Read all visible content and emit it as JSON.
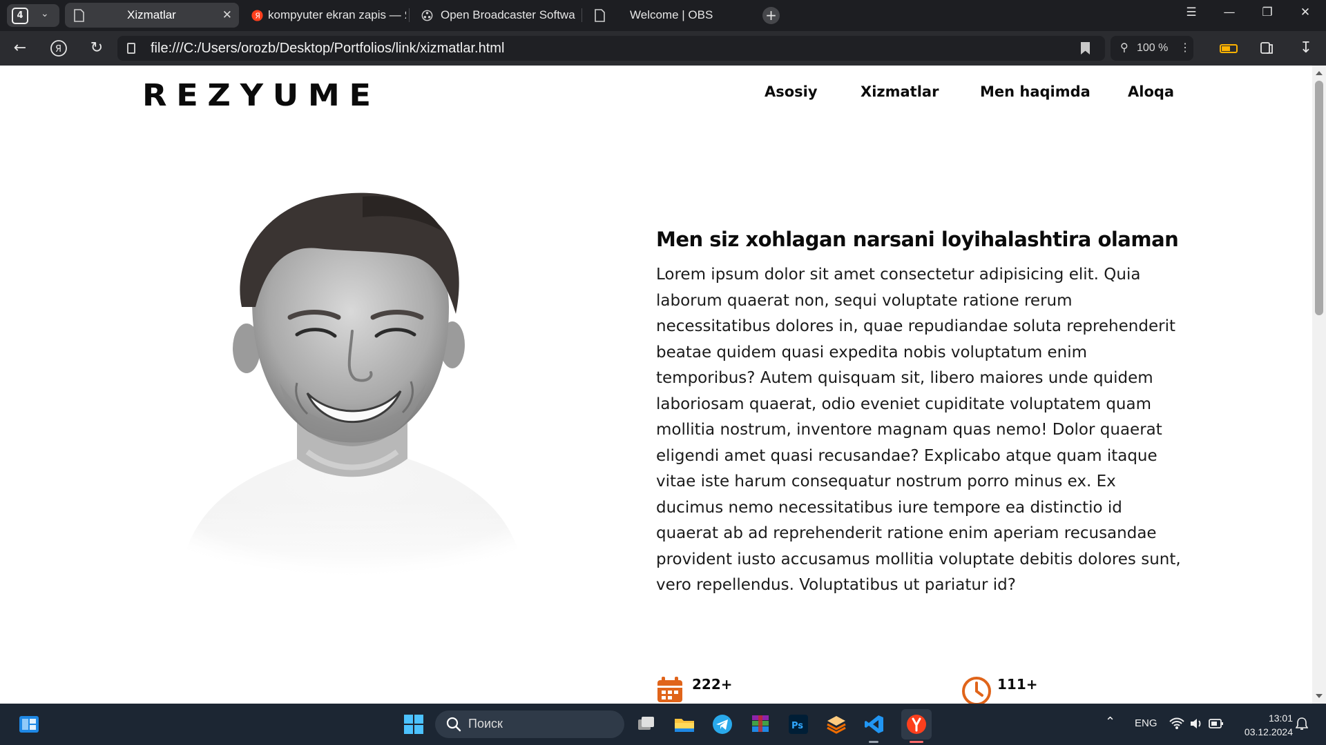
{
  "browser": {
    "tab_count": "4",
    "tabs": [
      {
        "label": "Xizmatlar",
        "active": true
      },
      {
        "label": "kompyuter ekran zapis — Я",
        "active": false
      },
      {
        "label": "Open Broadcaster Softwa",
        "active": false
      },
      {
        "label": "Welcome | OBS",
        "active": false
      }
    ],
    "url": "file:///C:/Users/orozb/Desktop/Portfolios/link/xizmatlar.html",
    "zoom": "100 %"
  },
  "site": {
    "logo": "REZYUME",
    "menu": [
      "Asosiy",
      "Xizmatlar",
      "Men haqimda",
      "Aloqa"
    ],
    "headline": "Men siz xohlagan narsani loyihalashtira olaman",
    "paragraph": "Lorem ipsum dolor sit amet consectetur adipisicing elit. Quia laborum quaerat non, sequi voluptate ratione rerum necessitatibus dolores in, quae repudiandae soluta reprehenderit beatae quidem quasi expedita nobis voluptatum enim temporibus? Autem quisquam sit, libero maiores unde quidem laboriosam quaerat, odio eveniet cupiditate voluptatem quam mollitia nostrum, inventore magnam quas nemo! Dolor quaerat eligendi amet quasi recusandae? Explicabo atque quam itaque vitae iste harum consequatur nostrum porro minus ex. Ex ducimus nemo necessitatibus iure tempore ea distinctio id quaerat ab ad reprehenderit ratione enim aperiam recusandae provident iusto accusamus mollitia voluptate debitis dolores sunt, vero repellendus. Voluptatibus ut pariatur id?",
    "stats": [
      {
        "value": "222+",
        "icon": "calendar-icon"
      },
      {
        "value": "111+",
        "icon": "clock-icon"
      }
    ],
    "accent_color": "#e0641a"
  },
  "taskbar": {
    "search_placeholder": "Поиск",
    "language": "ENG",
    "time": "13:01",
    "date": "03.12.2024"
  }
}
